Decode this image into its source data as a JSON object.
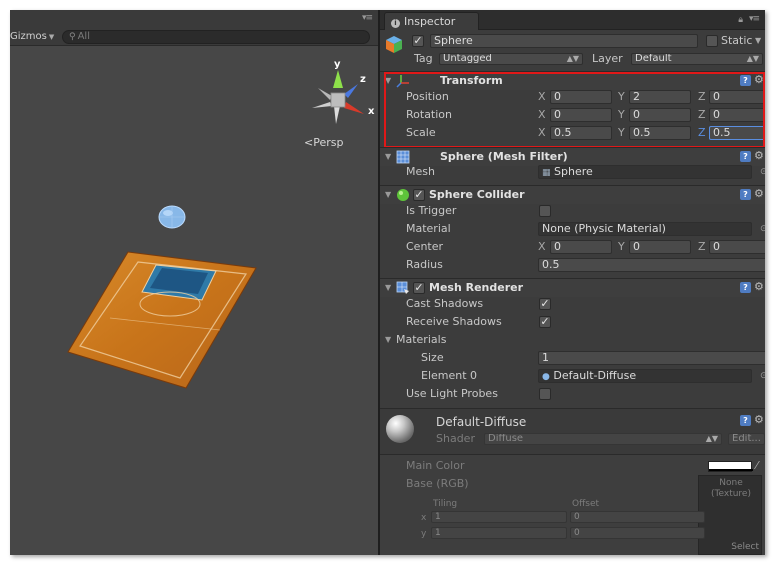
{
  "scene": {
    "gizmos_label": "Gizmos",
    "search_placeholder": "All",
    "persp_label": "Persp",
    "axis": {
      "y": "y",
      "z": "z",
      "x": "x"
    }
  },
  "inspector": {
    "tab_label": "Inspector",
    "object": {
      "name": "Sphere",
      "static_label": "Static",
      "static_checked": false,
      "active_checked": true,
      "tag_label": "Tag",
      "tag_value": "Untagged",
      "layer_label": "Layer",
      "layer_value": "Default"
    },
    "transform": {
      "title": "Transform",
      "position_label": "Position",
      "rotation_label": "Rotation",
      "scale_label": "Scale",
      "position": {
        "x": "0",
        "y": "2",
        "z": "0"
      },
      "rotation": {
        "x": "0",
        "y": "0",
        "z": "0"
      },
      "scale": {
        "x": "0.5",
        "y": "0.5",
        "z": "0.5"
      }
    },
    "mesh_filter": {
      "title": "Sphere (Mesh Filter)",
      "mesh_label": "Mesh",
      "mesh_value": "Sphere"
    },
    "sphere_collider": {
      "title": "Sphere Collider",
      "is_trigger_label": "Is Trigger",
      "material_label": "Material",
      "material_value": "None (Physic Material)",
      "center_label": "Center",
      "center": {
        "x": "0",
        "y": "0",
        "z": "0"
      },
      "radius_label": "Radius",
      "radius_value": "0.5"
    },
    "mesh_renderer": {
      "title": "Mesh Renderer",
      "cast_shadows_label": "Cast Shadows",
      "receive_shadows_label": "Receive Shadows",
      "materials_label": "Materials",
      "size_label": "Size",
      "size_value": "1",
      "element0_label": "Element 0",
      "element0_value": "Default-Diffuse",
      "use_light_probes_label": "Use Light Probes"
    },
    "material": {
      "name": "Default-Diffuse",
      "shader_label": "Shader",
      "shader_value": "Diffuse",
      "edit_label": "Edit...",
      "main_color_label": "Main Color",
      "base_label": "Base (RGB)",
      "texture_none": "None",
      "texture_type": "(Texture)",
      "tiling_label": "Tiling",
      "offset_label": "Offset",
      "tiling_x": "1",
      "tiling_y": "1",
      "offset_x": "0",
      "offset_y": "0",
      "select_label": "Select",
      "x_label": "x",
      "y_label": "y"
    },
    "axis_labels": {
      "x": "X",
      "y": "Y",
      "z": "Z"
    },
    "colors": {
      "highlight": "#e01818",
      "accent": "#4f7cc2"
    }
  }
}
